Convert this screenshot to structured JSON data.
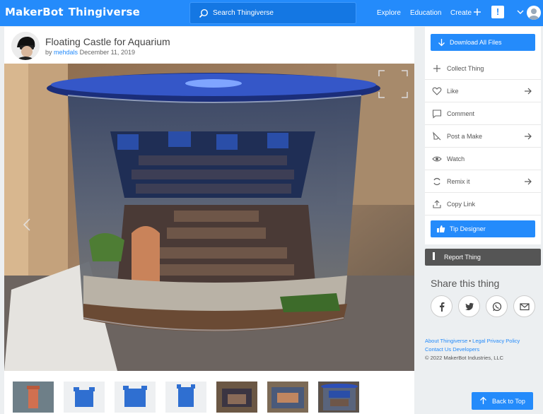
{
  "header": {
    "logo_part1": "MakerBot",
    "logo_part2": "Thingiverse",
    "search_placeholder": "Search Thingiverse",
    "nav": [
      "Explore",
      "Education",
      "Create"
    ],
    "alert_label": "!"
  },
  "thing": {
    "title": "Floating Castle for Aquarium",
    "by": "by",
    "author": "mehdals",
    "date": "December 11, 2019"
  },
  "thumbnails": [
    "castle-orange",
    "castle-blue-1",
    "castle-blue-2",
    "castle-blue-3",
    "castle-photo-1",
    "castle-photo-2",
    "castle-aquarium"
  ],
  "sidebar": {
    "download": "Download All Files",
    "actions": [
      {
        "label": "Collect Thing",
        "icon": "plus-icon",
        "arrow": false
      },
      {
        "label": "Like",
        "icon": "heart-icon",
        "arrow": true
      },
      {
        "label": "Comment",
        "icon": "comment-icon",
        "arrow": false
      },
      {
        "label": "Post a Make",
        "icon": "nozzle-icon",
        "arrow": true
      },
      {
        "label": "Watch",
        "icon": "eye-icon",
        "arrow": false
      },
      {
        "label": "Remix it",
        "icon": "remix-icon",
        "arrow": true
      },
      {
        "label": "Copy Link",
        "icon": "share-icon",
        "arrow": false
      }
    ],
    "tip": "Tip Designer",
    "report": "Report Thing",
    "share_title": "Share this thing",
    "share_icons": [
      "facebook-icon",
      "twitter-icon",
      "whatsapp-icon",
      "email-icon"
    ]
  },
  "footer": {
    "about": "About Thingiverse",
    "legal": "Legal",
    "privacy": "Privacy Policy",
    "contact": "Contact Us",
    "developers": "Developers",
    "copyright": "© 2022 MakerBot Industries, LLC"
  },
  "back_to_top": "Back to Top",
  "colors": {
    "brand": "#248bfb",
    "report": "#555555"
  }
}
